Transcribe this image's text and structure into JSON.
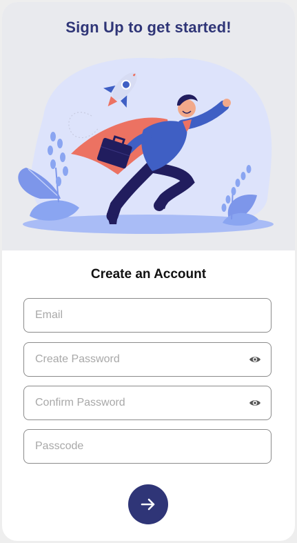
{
  "hero": {
    "title": "Sign Up to get started!",
    "illustration": "superhero-businessman-with-rocket"
  },
  "form": {
    "title": "Create an Account",
    "email": {
      "placeholder": "Email",
      "value": ""
    },
    "create_password": {
      "placeholder": "Create Password",
      "value": "",
      "toggle_icon": "eye-icon"
    },
    "confirm_password": {
      "placeholder": "Confirm Password",
      "value": "",
      "toggle_icon": "eye-icon"
    },
    "passcode": {
      "placeholder": "Passcode",
      "value": ""
    },
    "submit_icon": "arrow-right-icon"
  },
  "colors": {
    "primary": "#2f3577",
    "hero_bg": "#e9eaee",
    "blob": "#dde3fb",
    "accent_coral": "#ec7262",
    "accent_blue": "#3f5fc4"
  }
}
